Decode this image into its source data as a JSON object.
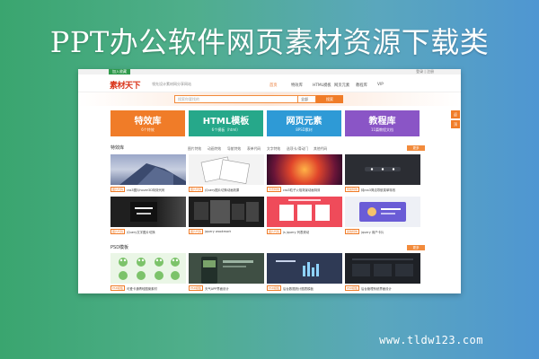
{
  "banner": {
    "title": "PPT办公软件网页素材资源下载类",
    "watermark": "www.tldw123.com"
  },
  "site": {
    "top_tag": "加入收藏",
    "top_links": "登录 | 注册",
    "logo": "素材天下",
    "logo_sub": "领先设计素材网分享网站",
    "nav": [
      "首页",
      "特效库",
      "HTML模板",
      "网页元素",
      "教程库",
      "VIP"
    ],
    "search": {
      "placeholder": "搜索你要找的",
      "select": "全部",
      "button": "搜索"
    },
    "tiles": [
      {
        "title": "特效库",
        "sub": "6个特效",
        "color": "#f07c28"
      },
      {
        "title": "HTML模板",
        "sub": "6个模板（html）",
        "color": "#26a88a"
      },
      {
        "title": "网页元素",
        "sub": "8PSD素材",
        "color": "#2e9ad6"
      },
      {
        "title": "教程库",
        "sub": "11篇教程文档",
        "color": "#8a55c6"
      }
    ],
    "float": [
      "返",
      "顶"
    ],
    "section1": {
      "title": "特效库",
      "tabs": [
        "图片特效",
        "动画特效",
        "导航特效",
        "表单代码",
        "文字特效",
        "选项卡/滑动门",
        "其他代码"
      ],
      "more": "更多"
    },
    "section2": {
      "title": "PSD模板",
      "more": "更多"
    },
    "row1": [
      {
        "badge": "图片代码",
        "caption": "css3图片hover3D特效代码"
      },
      {
        "badge": "图片代码",
        "caption": "jQuery图片切换动画效果"
      },
      {
        "badge": "背景特效",
        "caption": "css3粒子火焰背景动画特效"
      },
      {
        "badge": "导航特效",
        "caption": "纯css3简洁导航菜单特效"
      }
    ],
    "row2": [
      {
        "badge": "图片代码",
        "caption": "jQuery文字图片切换"
      },
      {
        "badge": "图片代码",
        "caption": "jquery wookmark"
      },
      {
        "badge": "图片代码",
        "caption": "js jquery 列表滚动"
      },
      {
        "badge": "其他特效",
        "caption": "jquery 用户卡片"
      }
    ],
    "row3": [
      {
        "badge": "PSD模板",
        "caption": "可爱卡通青蛙图案素材"
      },
      {
        "badge": "PSD模板",
        "caption": "天气APP界面设计"
      },
      {
        "badge": "PSD模板",
        "caption": "后台数据统计图表模板"
      },
      {
        "badge": "PSD模板",
        "caption": "后台管理系统界面设计"
      }
    ]
  }
}
